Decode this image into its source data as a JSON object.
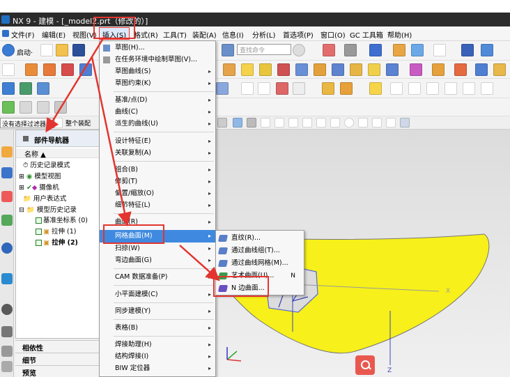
{
  "window": {
    "title": "NX 9 - 建模 - [_model2.prt（修改的）]"
  },
  "menubar": {
    "items": [
      "文件(F)",
      "编辑(E)",
      "视图(V)",
      "插入(S)",
      "格式(R)",
      "工具(T)",
      "装配(A)",
      "信息(I)",
      "分析(L)",
      "首选项(P)",
      "窗口(O)",
      "GC 工具箱",
      "帮助(H)"
    ]
  },
  "toolbar": {
    "start_label": "启动·",
    "search_placeholder": "查找命令"
  },
  "filter": {
    "selection_filter": "没有选择过滤器",
    "assembly_scope": "整个装配"
  },
  "navigator": {
    "title": "部件导航器",
    "column": "名称",
    "items": [
      {
        "label": "历史记录模式"
      },
      {
        "label": "模型视图"
      },
      {
        "label": "摄像机"
      },
      {
        "label": "用户表达式"
      },
      {
        "label": "模型历史记录"
      },
      {
        "label": "基准坐标系 (0)"
      },
      {
        "label": "拉伸 (1)"
      },
      {
        "label": "拉伸 (2)"
      }
    ]
  },
  "panels": [
    "相依性",
    "细节",
    "预览"
  ],
  "insert_menu": {
    "items": [
      {
        "label": "草图(H)...",
        "arrow": ""
      },
      {
        "label": "在任务环境中绘制草图(V)...",
        "arrow": ""
      },
      {
        "label": "草图曲线(S)",
        "arrow": "▸"
      },
      {
        "label": "草图约束(K)",
        "arrow": "▸"
      },
      {
        "label": "基准/点(D)",
        "arrow": "▸"
      },
      {
        "label": "曲线(C)",
        "arrow": "▸"
      },
      {
        "label": "派生的曲线(U)",
        "arrow": "▸"
      },
      {
        "label": "设计特征(E)",
        "arrow": "▸"
      },
      {
        "label": "关联复制(A)",
        "arrow": "▸"
      },
      {
        "label": "组合(B)",
        "arrow": "▸"
      },
      {
        "label": "修剪(T)",
        "arrow": "▸"
      },
      {
        "label": "偏置/缩放(O)",
        "arrow": "▸"
      },
      {
        "label": "细节特征(L)",
        "arrow": "▸"
      },
      {
        "label": "曲面(R)",
        "arrow": "▸"
      },
      {
        "label": "网格曲面(M)",
        "arrow": "▸"
      },
      {
        "label": "扫掠(W)",
        "arrow": "▸"
      },
      {
        "label": "弯边曲面(G)",
        "arrow": "▸"
      },
      {
        "label": "CAM 数据准备(P)",
        "arrow": "▸"
      },
      {
        "label": "小平面建模(C)",
        "arrow": "▸"
      },
      {
        "label": "同步建模(Y)",
        "arrow": "▸"
      },
      {
        "label": "表格(B)",
        "arrow": "▸"
      },
      {
        "label": "焊接助理(H)",
        "arrow": "▸"
      },
      {
        "label": "结构焊接(I)",
        "arrow": "▸"
      },
      {
        "label": "BIW 定位器",
        "arrow": "▸"
      }
    ]
  },
  "mesh_submenu": {
    "items": [
      {
        "label": "直纹(R)...",
        "shortcut": ""
      },
      {
        "label": "通过曲线组(T)...",
        "shortcut": ""
      },
      {
        "label": "通过曲线网格(M)...",
        "shortcut": ""
      },
      {
        "label": "艺术曲面(U)...",
        "shortcut": "N"
      },
      {
        "label": "N 边曲面...",
        "shortcut": ""
      }
    ]
  },
  "viewport": {
    "surface_color": "#f7f01a",
    "background": "#e6e6e6",
    "axis_labels": [
      "Y",
      "X",
      "Z"
    ]
  },
  "colors": {
    "highlight": "#3f8ae0",
    "annotation": "#e3342f"
  }
}
